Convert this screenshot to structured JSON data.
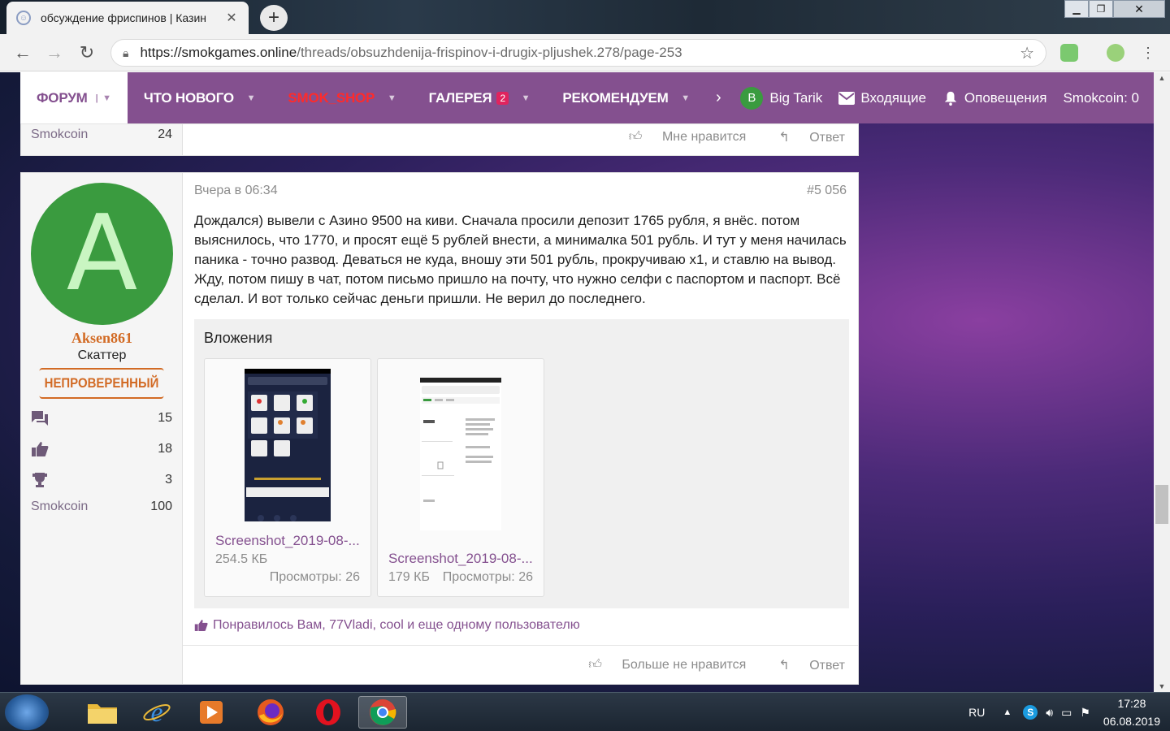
{
  "browser": {
    "tab_title": "обсуждение фриспинов | Казин",
    "url_host": "https://smokgames.online",
    "url_path": "/threads/obsuzhdenija-frispinov-i-drugix-pljushek.278/page-253"
  },
  "nav": {
    "items": [
      {
        "label": "ФОРУМ"
      },
      {
        "label": "ЧТО НОВОГО"
      },
      {
        "label": "SMOK_SHOP"
      },
      {
        "label": "ГАЛЕРЕЯ",
        "badge": "2"
      },
      {
        "label": "РЕКОМЕНДУЕМ"
      }
    ],
    "more": "›",
    "user_initial": "B",
    "user_name": "Big Tarik",
    "inbox": "Входящие",
    "alerts": "Оповещения",
    "smokcoin": "Smokcoin: 0"
  },
  "prev_post": {
    "smokcoin_label": "Smokcoin",
    "smokcoin_value": "24",
    "like": "Мне нравится",
    "reply": "Ответ"
  },
  "post": {
    "avatar_letter": "A",
    "username": "Aksen861",
    "user_title": "Скаттер",
    "banner": "НЕПРОВЕРЕННЫЙ",
    "stats": {
      "messages": "15",
      "likes": "18",
      "trophies": "3",
      "smokcoin_label": "Smokcoin",
      "smokcoin": "100"
    },
    "date": "Вчера в 06:34",
    "number": "#5 056",
    "text": "Дождался) вывели с Азино 9500 на киви. Сначала просили депозит 1765 рубля, я внёс. потом выяснилось, что 1770, и просят ещё 5 рублей внести, а минималка 501 рубль. И тут у меня начилась паника - точно развод. Деваться не куда, вношу эти 501 рубль, прокручиваю х1, и ставлю на вывод. Жду, потом пишу в чат, потом письмо пришло на почту, что нужно селфи с паспортом и паспорт. Всё сделал. И вот только сейчас деньги пришли. Не верил до последнего.",
    "attachments_title": "Вложения",
    "attachments": [
      {
        "name": "Screenshot_2019-08-...",
        "size": "254.5 КБ",
        "views": "Просмотры: 26"
      },
      {
        "name": "Screenshot_2019-08-...",
        "size": "179 КБ",
        "views": "Просмотры: 26"
      }
    ],
    "likes_text": "Понравилось Вам, 77Vladi, cool и еще одному пользователю",
    "unlike": "Больше не нравится",
    "reply": "Ответ"
  },
  "taskbar": {
    "lang": "RU",
    "time": "17:28",
    "date": "06.08.2019"
  },
  "colors": {
    "accent": "#84508f",
    "avatar_green": "#3a9b3f",
    "banner_orange": "#d26b25",
    "shop_red": "#ff2a2a"
  }
}
